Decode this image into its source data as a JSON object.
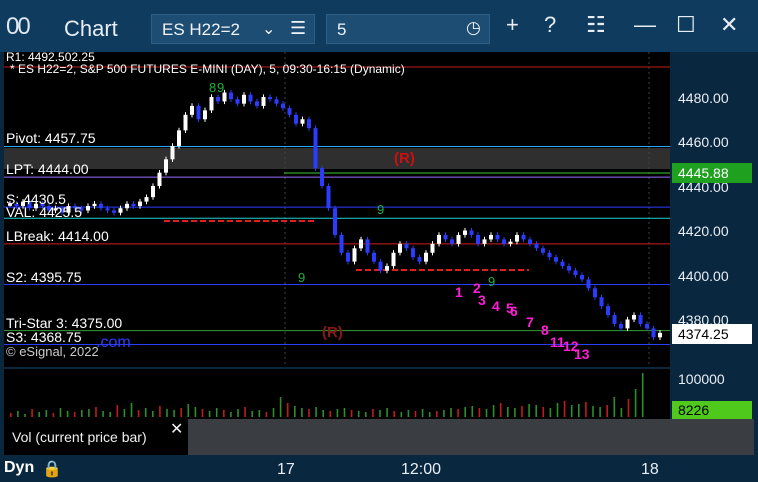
{
  "window": {
    "title": "Chart",
    "app_icon": "00",
    "symbol": "ES H22=2",
    "interval": "5"
  },
  "toolbar": {
    "add_icon": "+",
    "help_icon": "?",
    "layout_icon": "☷",
    "maximize_icon": "☐",
    "close_icon": "✕"
  },
  "chart": {
    "header": "* ES H22=2, S&P 500 FUTURES E-MINI (DAY), 5, 09:30-16:15 (Dynamic)",
    "r1_label": "R1: 4492.502.25",
    "copyright": "© eSignal, 2022",
    "levels": [
      {
        "label": "Pivot: 4457.75",
        "price": 4457.75,
        "color": "#2aa7ff"
      },
      {
        "label": "LPT: 4444.00",
        "price": 4444.0,
        "color": "#9b6cff"
      },
      {
        "label": "S: 4430.5",
        "price": 4430.5,
        "color": "#2b3cff"
      },
      {
        "label": "VAL: 4425.5",
        "price": 4425.5,
        "color": "#1fd0d0"
      },
      {
        "label": "LBreak: 4414.00",
        "price": 4414.0,
        "color": "#d21d1d"
      },
      {
        "label": "S2: 4395.75",
        "price": 4395.75,
        "color": "#2b3cff"
      },
      {
        "label": "Tri-Star 3: 4375.00",
        "price": 4375.0,
        "color": "#2fa02f"
      },
      {
        "label": "S3: 4368.75",
        "price": 4368.75,
        "color": "#2b3cff"
      }
    ],
    "r_badge": "(R)",
    "countdown": [
      "1",
      "2",
      "3",
      "4",
      "5",
      "6",
      "7",
      "8",
      "11",
      "12",
      "13"
    ],
    "setup_nums": [
      "8",
      "9",
      "9",
      "9",
      "9"
    ]
  },
  "price_axis": {
    "ticks": [
      "4480.00",
      "4460.00",
      "4440.00",
      "4420.00",
      "4400.00",
      "4380.00"
    ],
    "last_price": "4374.25",
    "green_price": "4445.88",
    "vol_tick": "100000",
    "vol_last": "8226"
  },
  "time_axis": {
    "dyn_label": "Dyn",
    "labels": [
      "17",
      "12:00",
      "18"
    ]
  },
  "vol_panel": {
    "label": "Vol (current price bar)",
    "close": "✕"
  },
  "colors": {
    "up_candle": "#ffffff",
    "down_candle": "#2b3cff",
    "countdown": "#ff1dd6",
    "last_price_bg": "#ffffff",
    "green_price_bg": "#1fa01f",
    "vol_last_bg": "#4fc91b"
  }
}
